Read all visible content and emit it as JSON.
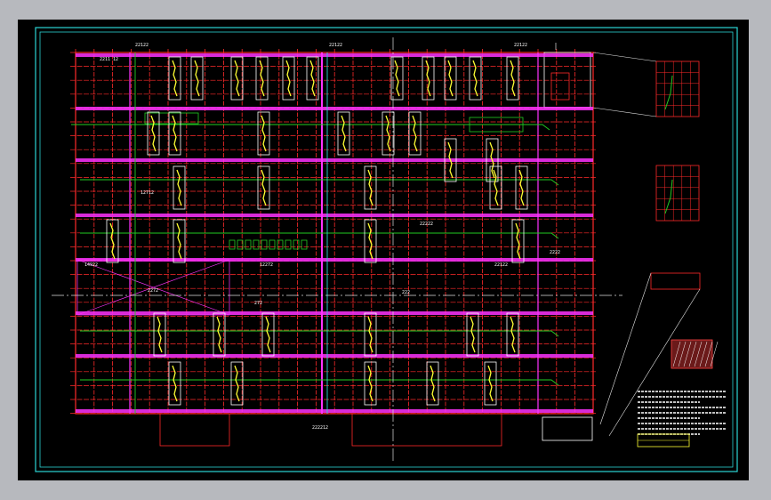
{
  "drawing": {
    "colors": {
      "background": "#000000",
      "outer_frame": "#2bd4d4",
      "inner_frame": "#2bd4d4",
      "grid_red": "#ff2a2a",
      "beam_magenta": "#ff33ff",
      "pipe_green": "#22cc22",
      "rebar_yellow": "#ffff33",
      "annotation_white": "#ffffff",
      "leader_white": "#e6e6e6",
      "ui_backdrop": "#b7b9be"
    },
    "labels": {
      "top_dim_left": "22122",
      "top_dim_mid": "22122",
      "top_dim_right": "22122",
      "room_code": "2211 12",
      "section_tag_a": "1",
      "section_tag_b": "2",
      "band_dim_left": "14922",
      "band_dim_mid": "12272",
      "band_dim_right": "22122",
      "band_dim_far": "2222",
      "mid_label_a": "2272",
      "mid_label_b": "272",
      "mid_label_c": "222",
      "row_label_a": "12712",
      "row_label_b": "22222",
      "bottom_dim": "222212"
    }
  }
}
